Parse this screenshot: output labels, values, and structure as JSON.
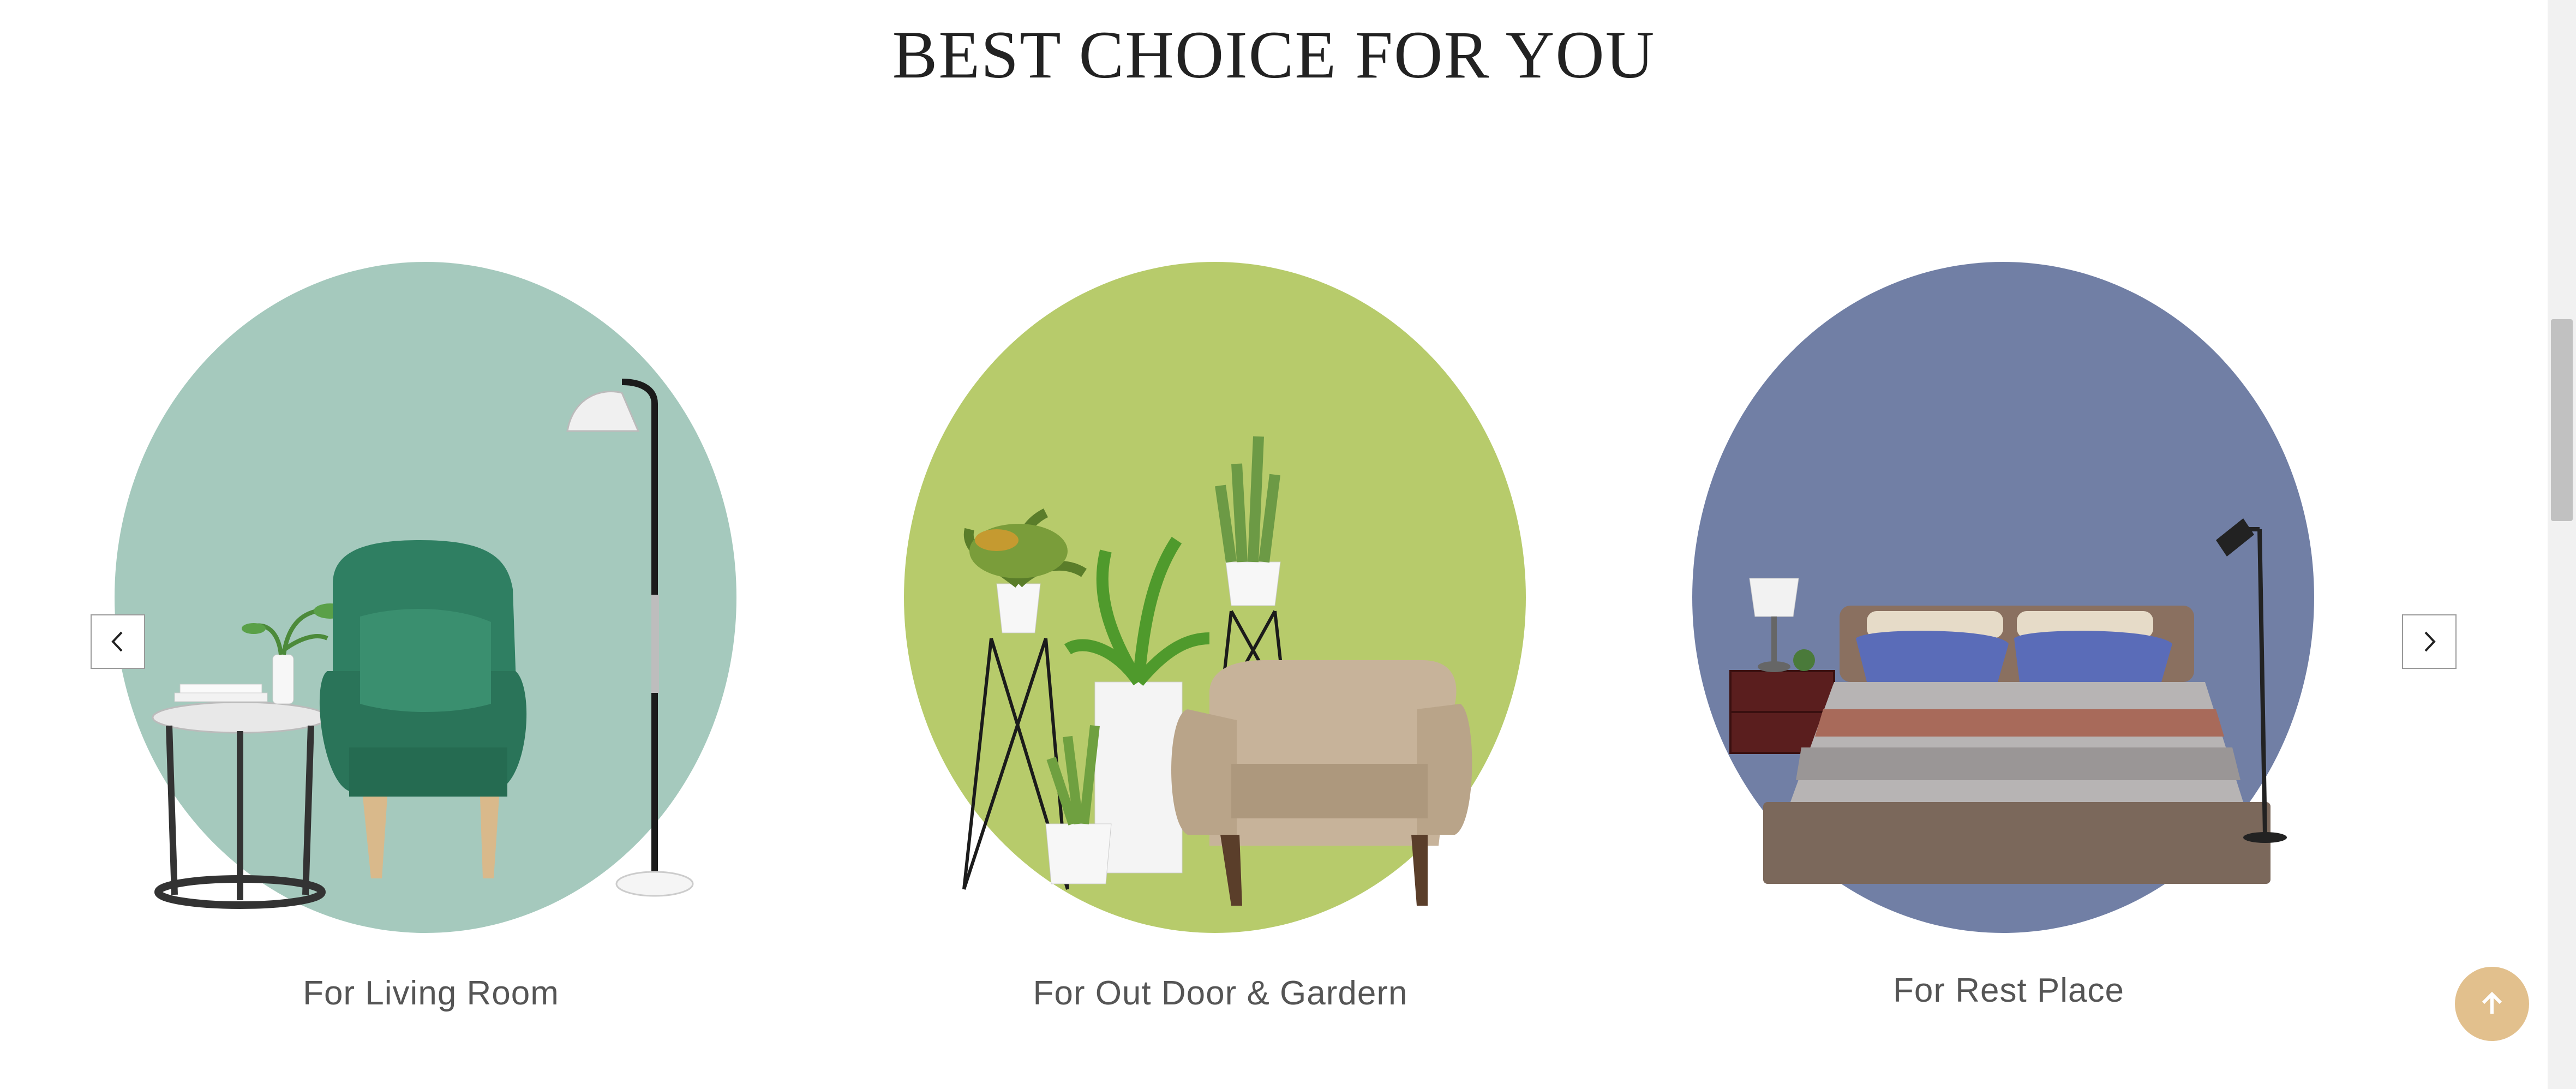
{
  "section": {
    "title": "BEST CHOICE FOR YOU"
  },
  "cards": [
    {
      "label": "For Living Room",
      "circle_color": "#a5c9bd"
    },
    {
      "label": "For Out Door & Gardern",
      "circle_color": "#b7cb6b"
    },
    {
      "label": "For Rest Place",
      "circle_color": "#717fa5"
    }
  ],
  "carousel": {
    "prev_icon": "chevron-left-icon",
    "next_icon": "chevron-right-icon"
  },
  "back_to_top": {
    "icon": "arrow-up-icon",
    "color": "#e2c08d"
  }
}
